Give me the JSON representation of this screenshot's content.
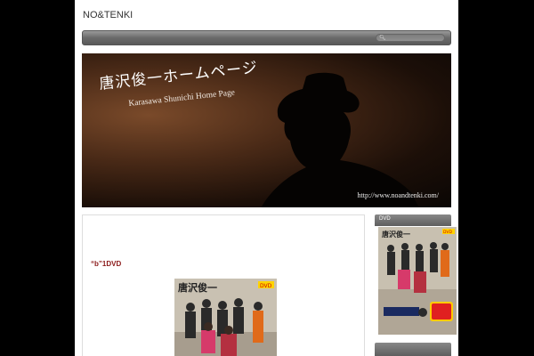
{
  "site": {
    "title": "NO&TENKI"
  },
  "nav": {
    "search_icon": "search-icon"
  },
  "banner": {
    "title_jp": "唐沢俊一ホームページ",
    "title_en": "Karasawa Shunichi Home Page",
    "url": "http://www.noandtenki.com/"
  },
  "post": {
    "title": "“b”1DVD",
    "cover_title": "唐沢俊一",
    "cover_badge": "DVD"
  },
  "sidebar": {
    "widget_title": "DVD",
    "cover_title": "唐沢俊一",
    "cover_badge": "DVD"
  }
}
